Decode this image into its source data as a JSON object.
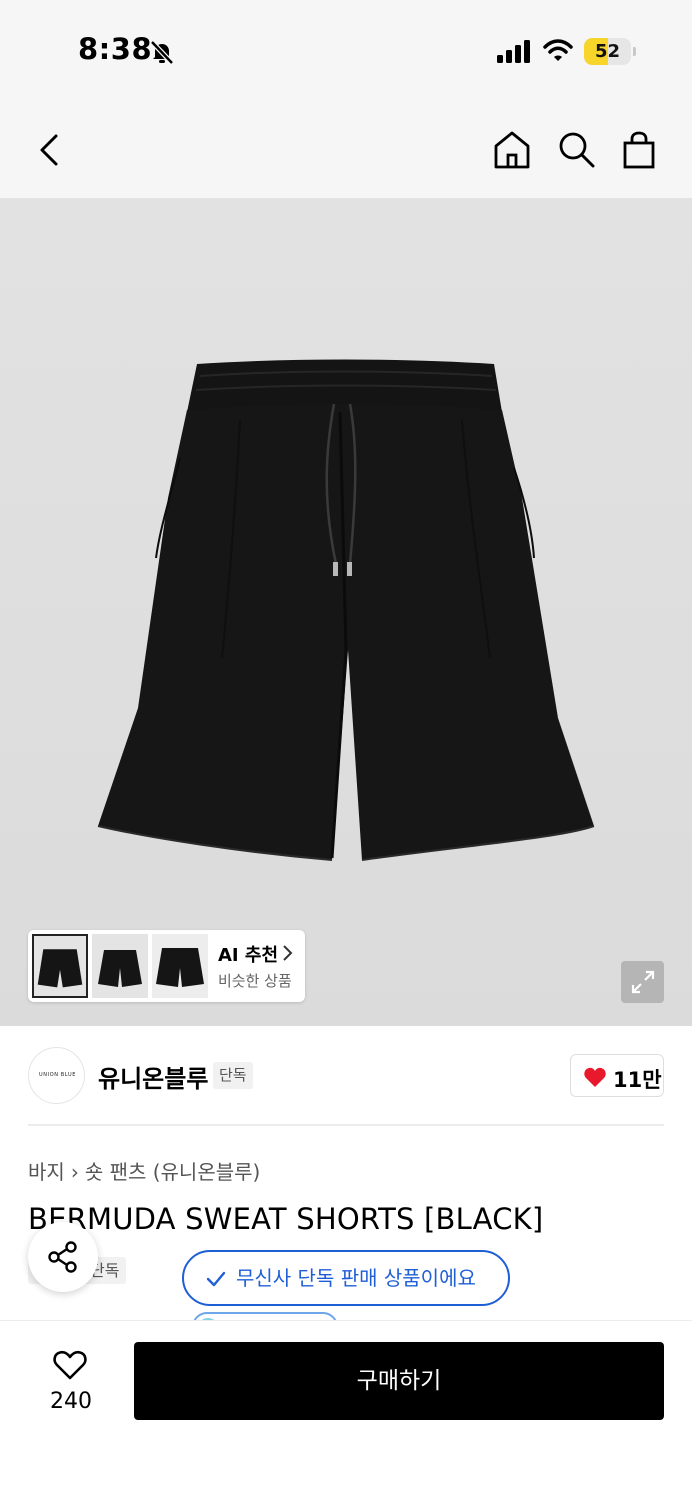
{
  "status_bar": {
    "time": "8:38",
    "battery_level": "52",
    "battery_fraction": 0.52,
    "icons": [
      "bell-slash-icon",
      "cellular-signal-icon",
      "wifi-icon",
      "battery-icon"
    ]
  },
  "nav": {
    "icons": [
      "back-chevron-icon",
      "home-icon",
      "search-icon",
      "shopping-bag-icon"
    ]
  },
  "gallery": {
    "ai_recommend": {
      "title": "AI 추천",
      "subtitle": "비슷한 상품"
    },
    "expand_icon": "expand-arrows-icon"
  },
  "brand": {
    "logo_text": "UNION BLUE",
    "name": "유니온블루",
    "badge": "단독",
    "like_count": "11만",
    "like_color": "#e8192c"
  },
  "breadcrumb": {
    "category": "바지",
    "subcategory": "숏 팬츠 (유니온블루)"
  },
  "product": {
    "title": "BERMUDA SWEAT SHORTS [BLACK]",
    "tag": "단독"
  },
  "toast": {
    "message": "무신사 단독 판매 상품이에요",
    "color": "#1f5fd6"
  },
  "bottom_bar": {
    "wish_count": "240",
    "buy_label": "구매하기"
  }
}
